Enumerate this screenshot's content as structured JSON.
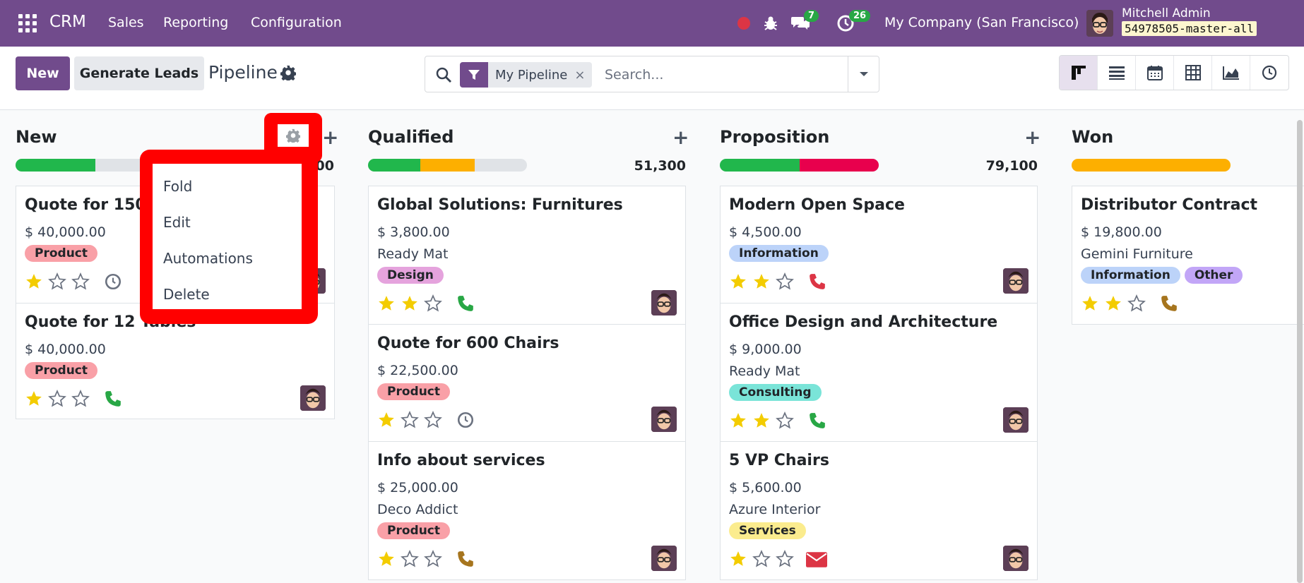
{
  "navbar": {
    "brand": "CRM",
    "menu": [
      "Sales",
      "Reporting",
      "Configuration"
    ],
    "messages_count": "7",
    "activities_count": "26",
    "company": "My Company (San Francisco)",
    "user_name": "Mitchell Admin",
    "database": "54978505-master-all"
  },
  "control": {
    "new_label": "New",
    "generate_label": "Generate Leads",
    "title": "Pipeline",
    "facet_label": "My Pipeline",
    "facet_close": "×",
    "search_placeholder": "Search..."
  },
  "columns": [
    {
      "title": "New",
      "plus": "+",
      "total": "00"
    },
    {
      "title": "Qualified",
      "plus": "+",
      "total": "51,300"
    },
    {
      "title": "Proposition",
      "plus": "+",
      "total": "79,100"
    },
    {
      "title": "Won"
    }
  ],
  "cards": {
    "new": [
      {
        "title": "Quote for 150 c",
        "amount": "$ 40,000.00",
        "tags": [
          "Product"
        ]
      },
      {
        "title": "Quote for 12 Tables",
        "amount": "$ 40,000.00",
        "tags": [
          "Product"
        ]
      }
    ],
    "qualified": [
      {
        "title": "Global Solutions: Furnitures",
        "amount": "$ 3,800.00",
        "company": "Ready Mat",
        "tags": [
          "Design"
        ]
      },
      {
        "title": "Quote for 600 Chairs",
        "amount": "$ 22,500.00",
        "tags": [
          "Product"
        ]
      },
      {
        "title": "Info about services",
        "amount": "$ 25,000.00",
        "company": "Deco Addict",
        "tags": [
          "Product"
        ]
      }
    ],
    "proposition": [
      {
        "title": "Modern Open Space",
        "amount": "$ 4,500.00",
        "tags": [
          "Information"
        ]
      },
      {
        "title": "Office Design and Architecture",
        "amount": "$ 9,000.00",
        "company": "Ready Mat",
        "tags": [
          "Consulting"
        ]
      },
      {
        "title": "5 VP Chairs",
        "amount": "$ 5,600.00",
        "company": "Azure Interior",
        "tags": [
          "Services"
        ]
      }
    ],
    "won": [
      {
        "title": "Distributor Contract",
        "amount": "$ 19,800.00",
        "company": "Gemini Furniture",
        "tags": [
          "Information",
          "Other"
        ]
      }
    ]
  },
  "dropdown": [
    "Fold",
    "Edit",
    "Automations",
    "Delete"
  ],
  "colors": {
    "brand": "#714b8c",
    "highlight": "#ff0000",
    "progress_green": "#21b74c",
    "progress_orange": "#fdaf00",
    "progress_red": "#e8004d",
    "tag_product": "#f9a0a7",
    "tag_design": "#e5a3dd",
    "tag_information": "#bcd3f9",
    "tag_consulting": "#7ae4d8",
    "tag_services": "#fbec8e",
    "tag_other": "#c2a6f7"
  }
}
